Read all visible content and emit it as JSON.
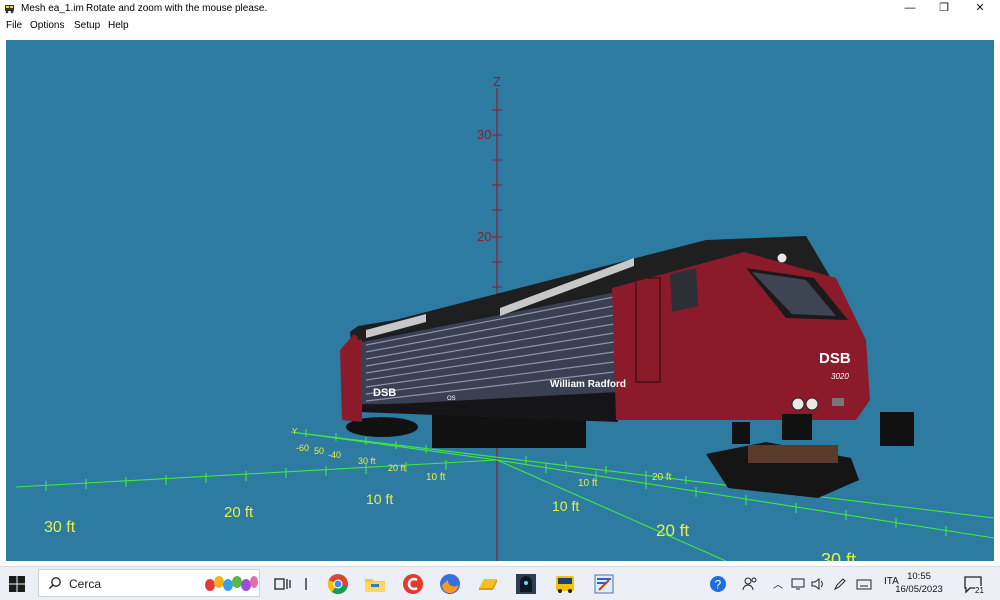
{
  "window": {
    "title": "Mesh ea_1.im",
    "subtitle": "Rotate and zoom with the mouse please.",
    "controls": {
      "minimize": "—",
      "restore": "❐",
      "close": "✕"
    }
  },
  "menu": {
    "items": [
      "File",
      "Options",
      "Setup",
      "Help"
    ]
  },
  "scene": {
    "z_axis_label": "Z",
    "y_axis_label": "Y",
    "z_ticks": [
      "30",
      "20"
    ],
    "grid_labels_front": [
      "30 ft",
      "20 ft",
      "10 ft",
      "10 ft",
      "20 ft",
      "30 ft"
    ],
    "grid_labels_back": [
      "-60",
      "50",
      "-40",
      "30 ft",
      "20 ft",
      "10 ft",
      "10 ft",
      "20 ft"
    ],
    "locomotive": {
      "operator_logo": "DSB",
      "number": "3020",
      "name": "William Radford",
      "side_logo": "DSB",
      "side_code": "OS",
      "body_color": "#8b1b2b",
      "roof_color": "#1f1f1f"
    },
    "colors": {
      "background": "#2d7ba1",
      "grid": "#41e840",
      "grid_labels": "#e7f04a",
      "z_axis": "#8c1f2e"
    }
  },
  "taskbar": {
    "search_placeholder": "Cerca",
    "pinned_icons": [
      "task-view-icon",
      "chrome-icon",
      "file-explorer-icon",
      "ccleaner-icon",
      "firefox-icon",
      "files-icon",
      "game-app-icon",
      "bus-app-icon",
      "editor-app-icon"
    ],
    "tray": {
      "language": "ITA",
      "time": "10:55",
      "date": "16/05/2023",
      "notification_count": "21"
    }
  }
}
